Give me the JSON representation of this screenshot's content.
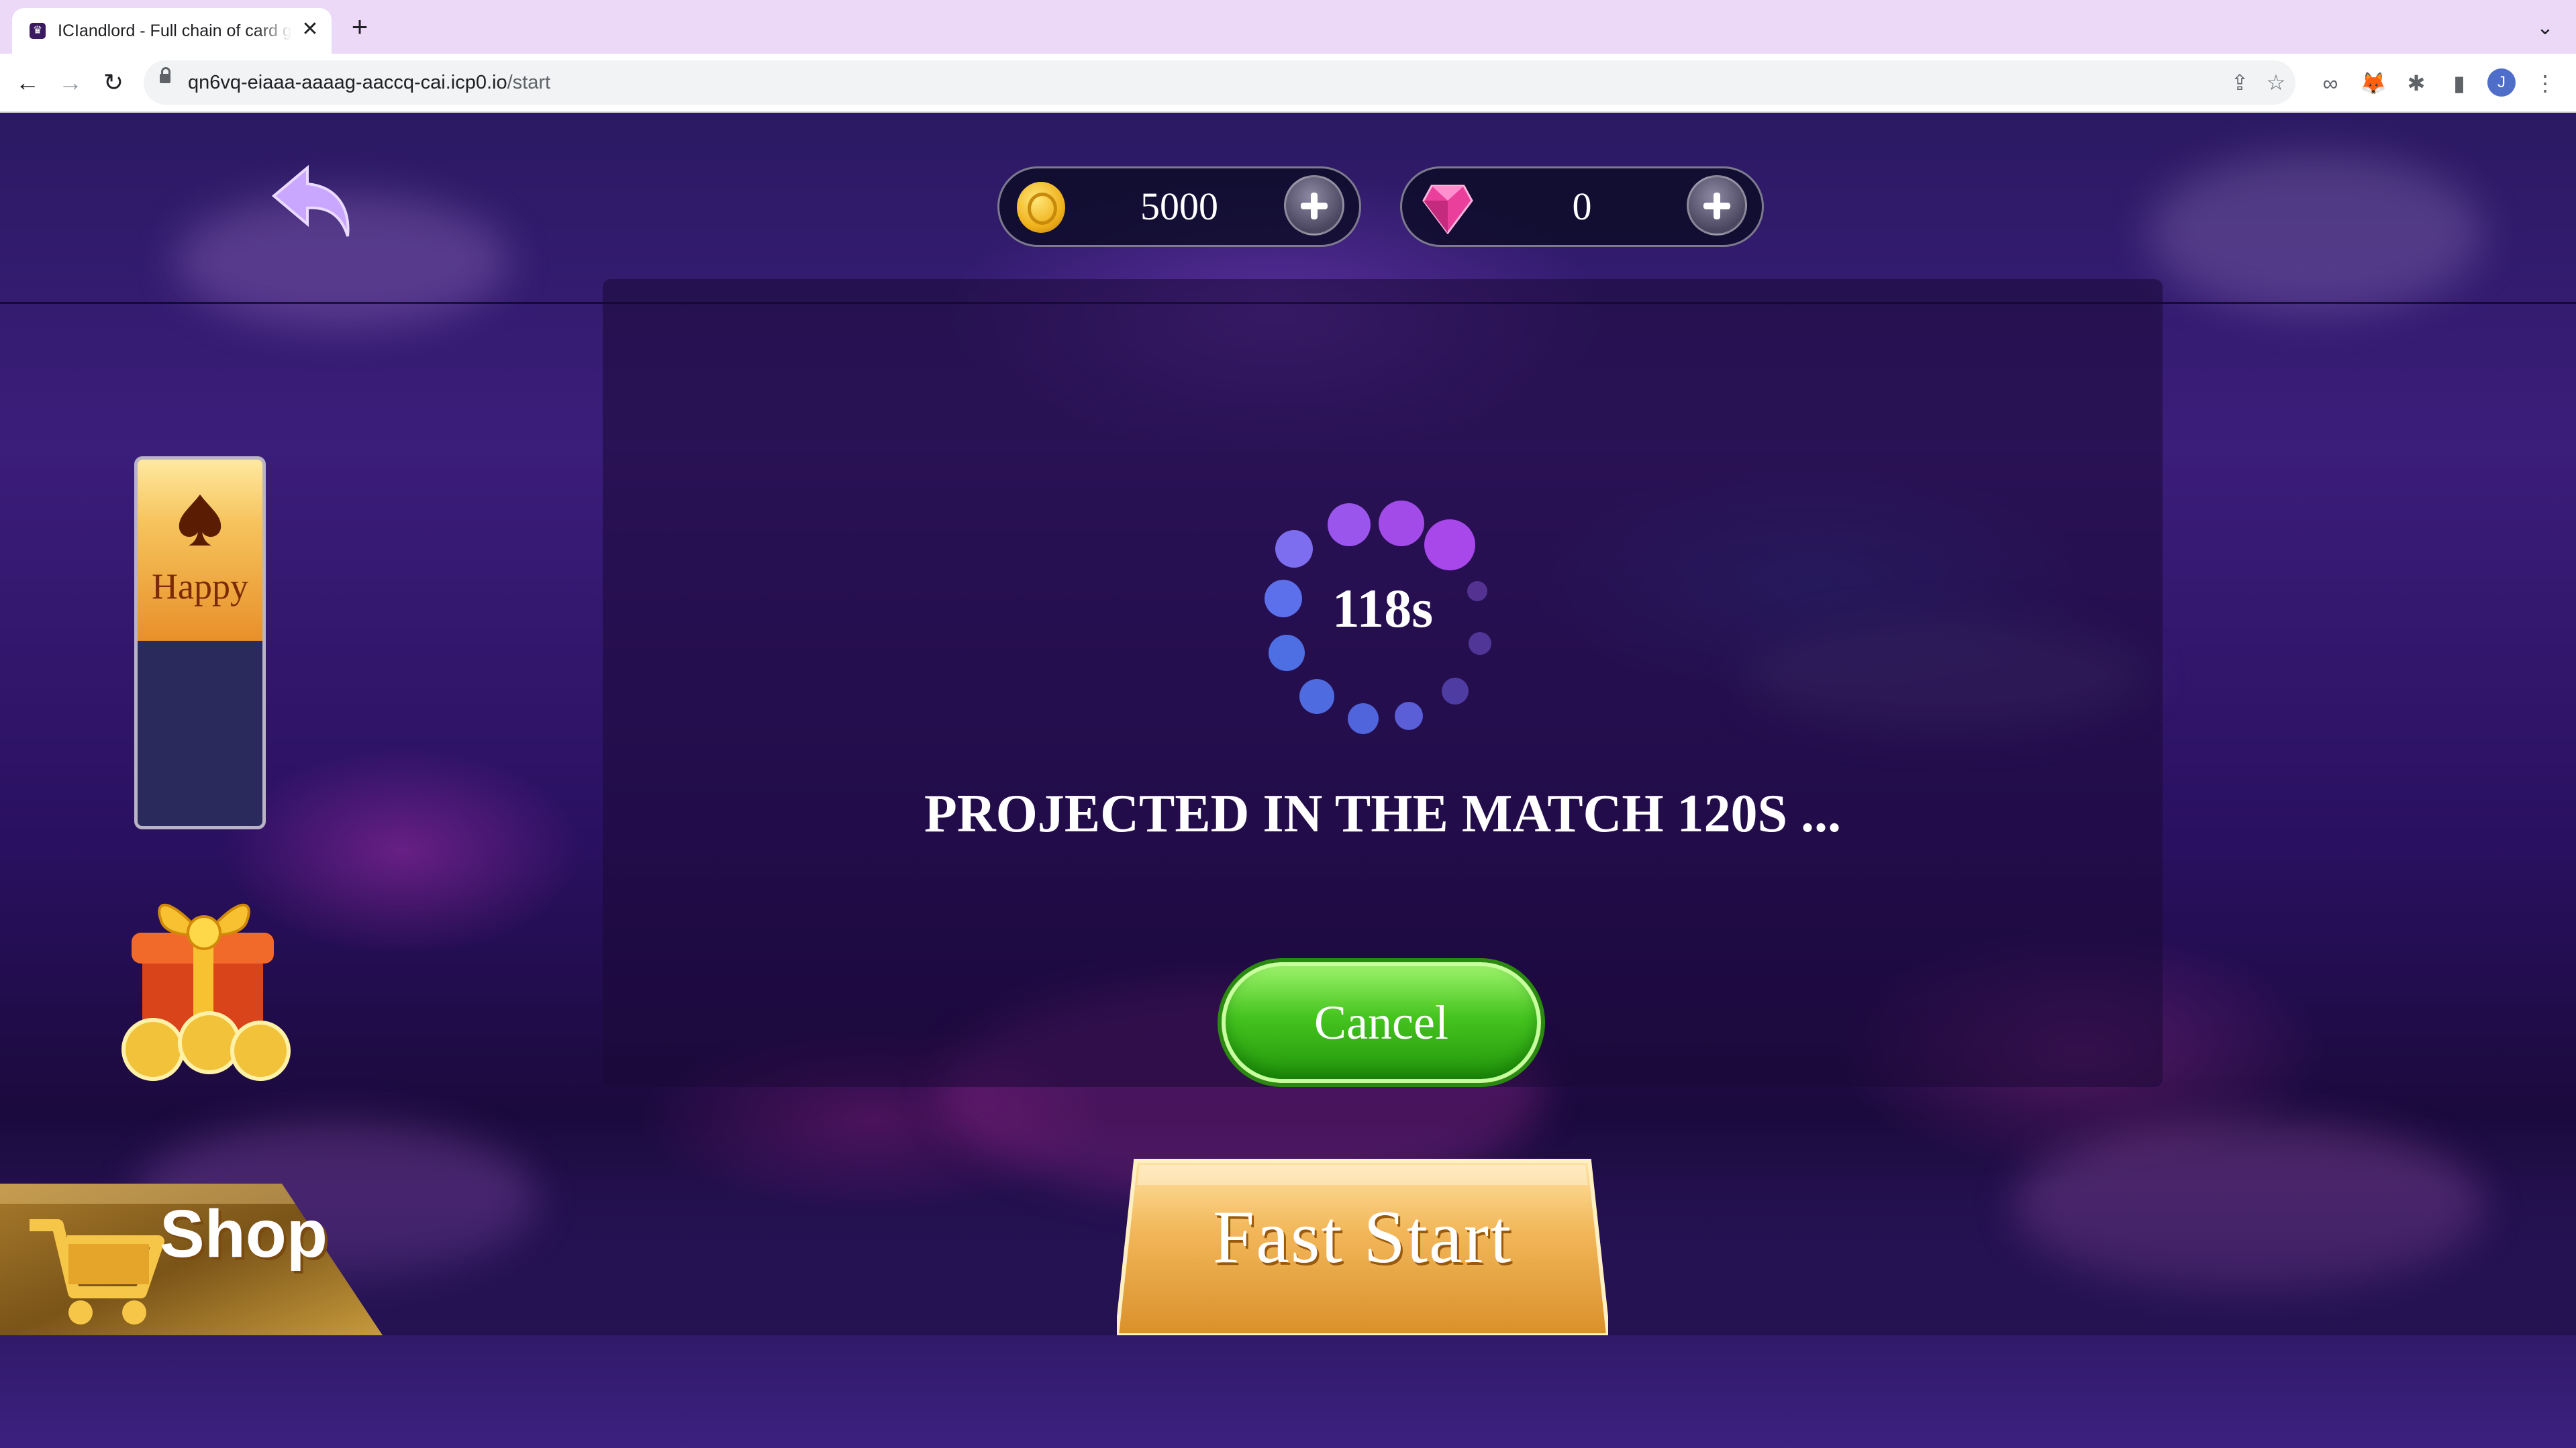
{
  "browser": {
    "tab_title": "ICIandlord - Full chain of card game",
    "tab_favicon": "♛",
    "close_glyph": "✕",
    "new_tab_glyph": "+",
    "tab_list_glyph": "⌄",
    "url_host": "qn6vq-eiaaa-aaaag-aaccq-cai.icp0.io",
    "url_path": "/start",
    "avatar_initial": "J"
  },
  "toolbar": {
    "back_glyph": "←",
    "forward_glyph": "→",
    "reload_glyph": "↻",
    "share_glyph": "⇪",
    "bookmark_glyph": "☆",
    "ext1_glyph": "∞",
    "ext2_glyph": "🦊",
    "ext3_glyph": "✱",
    "sidepanel_glyph": "▮",
    "menu_glyph": "⋮"
  },
  "game": {
    "coins": "5000",
    "gems": "0",
    "mode_label": "Happy",
    "countdown": "118s",
    "message": "PROJECTED IN THE MATCH 120S ...",
    "cancel_label": "Cancel",
    "shop_label": "Shop",
    "fast_start_label": "Fast Start"
  },
  "colors": {
    "accent_green": "#45c41f",
    "gold": "#f0b21c",
    "gem_pink": "#ea3f9b",
    "spinner_purple": "#a24be8",
    "spinner_blue": "#4f6be0"
  }
}
